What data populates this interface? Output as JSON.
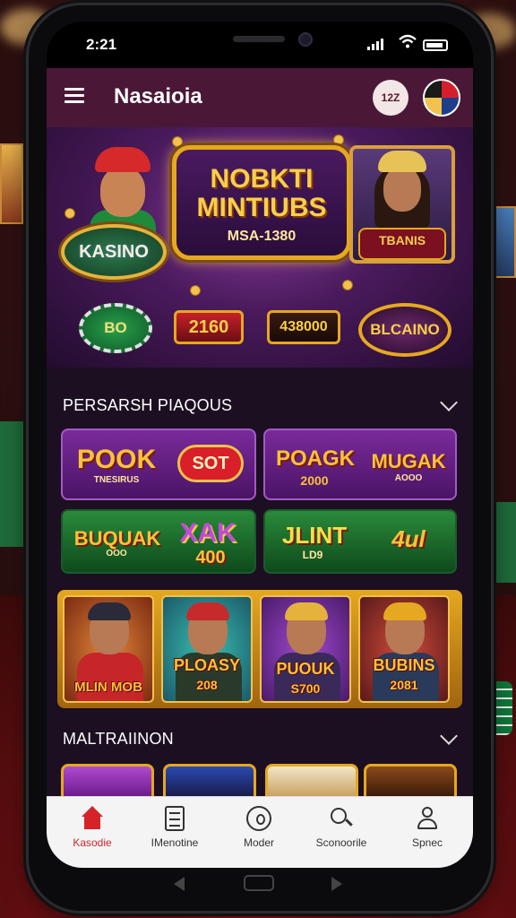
{
  "status": {
    "time": "2:21"
  },
  "app": {
    "title": "Nasaioia",
    "badge_text": "12Z"
  },
  "hero": {
    "left_badge": "KASINO",
    "sign_line1": "NOBKTI",
    "sign_line2": "MINTIUBS",
    "sign_line3": "MSA-1380",
    "right_plate": "TBANIS",
    "chip_value": "BO",
    "plaque_a": "2160",
    "plaque_b": "438000",
    "oval": "BLCAINO"
  },
  "section1": {
    "title": "PERSARSH PIAQOUS",
    "tiles": [
      {
        "main": "POOK",
        "sub": "TNESIRUS",
        "pill": "SOT"
      },
      {
        "main": "POAGK",
        "sub": "2000",
        "side": "MUGAK",
        "side_sub": "AOOO"
      },
      {
        "main": "BUQUAK",
        "sub": "OOO",
        "side": "XAK",
        "side_sub": "400"
      },
      {
        "main": "JLINT",
        "sub": "LD9",
        "side": "4ul"
      }
    ],
    "cards": [
      {
        "label": "MLIN MOB"
      },
      {
        "label": "PLOASY",
        "sub": "208"
      },
      {
        "label": "PUOUK",
        "sub": "S700"
      },
      {
        "label": "BUBINS",
        "sub": "2081"
      }
    ]
  },
  "section2": {
    "title": "MALTRAIINON"
  },
  "nav": {
    "items": [
      {
        "label": "Kasodie",
        "icon": "home-icon"
      },
      {
        "label": "IMenotine",
        "icon": "document-icon"
      },
      {
        "label": "Moder",
        "icon": "circle-icon"
      },
      {
        "label": "Sconoorile",
        "icon": "search-icon"
      },
      {
        "label": "Spnec",
        "icon": "person-icon"
      }
    ]
  },
  "colors": {
    "accent": "#d6232a",
    "header": "#4a1836",
    "gold": "#e5a820"
  }
}
